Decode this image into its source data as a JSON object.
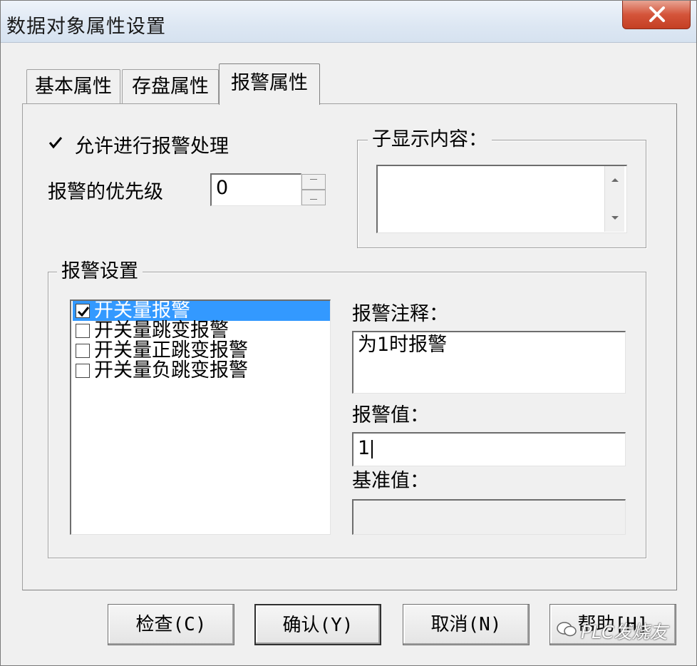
{
  "window": {
    "title": "数据对象属性设置"
  },
  "tabs": [
    {
      "label": "基本属性"
    },
    {
      "label": "存盘属性"
    },
    {
      "label": "报警属性"
    }
  ],
  "alarm_panel": {
    "allow_alarm_label": "允许进行报警处理",
    "allow_alarm_checked": true,
    "priority_label": "报警的优先级",
    "priority_value": "0",
    "sub_display_group_title": "子显示内容：",
    "sub_display_value": "",
    "alarm_settings_title": "报警设置",
    "alarm_types": [
      {
        "label": "开关量报警",
        "checked": true,
        "selected": true
      },
      {
        "label": "开关量跳变报警",
        "checked": false,
        "selected": false
      },
      {
        "label": "开关量正跳变报警",
        "checked": false,
        "selected": false
      },
      {
        "label": "开关量负跳变报警",
        "checked": false,
        "selected": false
      }
    ],
    "comment_label": "报警注释：",
    "comment_value": "为1时报警",
    "alarm_value_label": "报警值：",
    "alarm_value": "1",
    "base_value_label": "基准值：",
    "base_value": ""
  },
  "buttons": {
    "check": "检查(C)",
    "confirm": "确认(Y)",
    "cancel": "取消(N)",
    "help": "帮助[H]"
  },
  "watermark": "PLC发烧友",
  "icons": {
    "close": "close-icon",
    "spin_up": "spin-up-icon",
    "spin_down": "spin-down-icon",
    "scroll_up": "scroll-up-arrow-icon",
    "scroll_down": "scroll-down-arrow-icon"
  },
  "colors": {
    "selection": "#3399ff",
    "close_button": "#c43f23",
    "background": "#f0f0f0"
  }
}
